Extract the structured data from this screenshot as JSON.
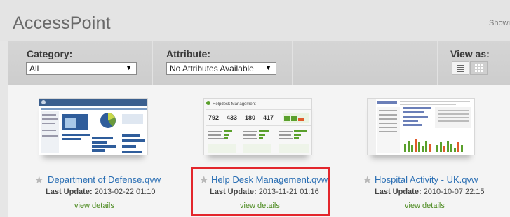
{
  "header": {
    "title": "AccessPoint",
    "showing_text": "Showi"
  },
  "filters": {
    "category": {
      "label": "Category:",
      "value": "All"
    },
    "attribute": {
      "label": "Attribute:",
      "value": "No Attributes Available"
    },
    "view_as": {
      "label": "View as:",
      "options": [
        "list-view-icon",
        "grid-view-icon"
      ],
      "selected": "grid-view-icon"
    }
  },
  "documents": [
    {
      "title": "Department of Defense.qvw",
      "update_label": "Last Update:",
      "update_value": "2013-02-22 01:10",
      "details_label": "view details"
    },
    {
      "title": "Help Desk Management.qvw",
      "update_label": "Last Update:",
      "update_value": "2013-11-21 01:16",
      "details_label": "view details",
      "thumb": {
        "heading": "Helpdesk Management",
        "kpis": [
          "792",
          "433",
          "180",
          "417"
        ]
      }
    },
    {
      "title": "Hospital Activity - UK.qvw",
      "update_label": "Last Update:",
      "update_value": "2010-10-07 22:15",
      "details_label": "view details"
    }
  ],
  "colors": {
    "link": "#2b6fb4",
    "details": "#4b8a1e",
    "highlight": "#e3262c"
  }
}
